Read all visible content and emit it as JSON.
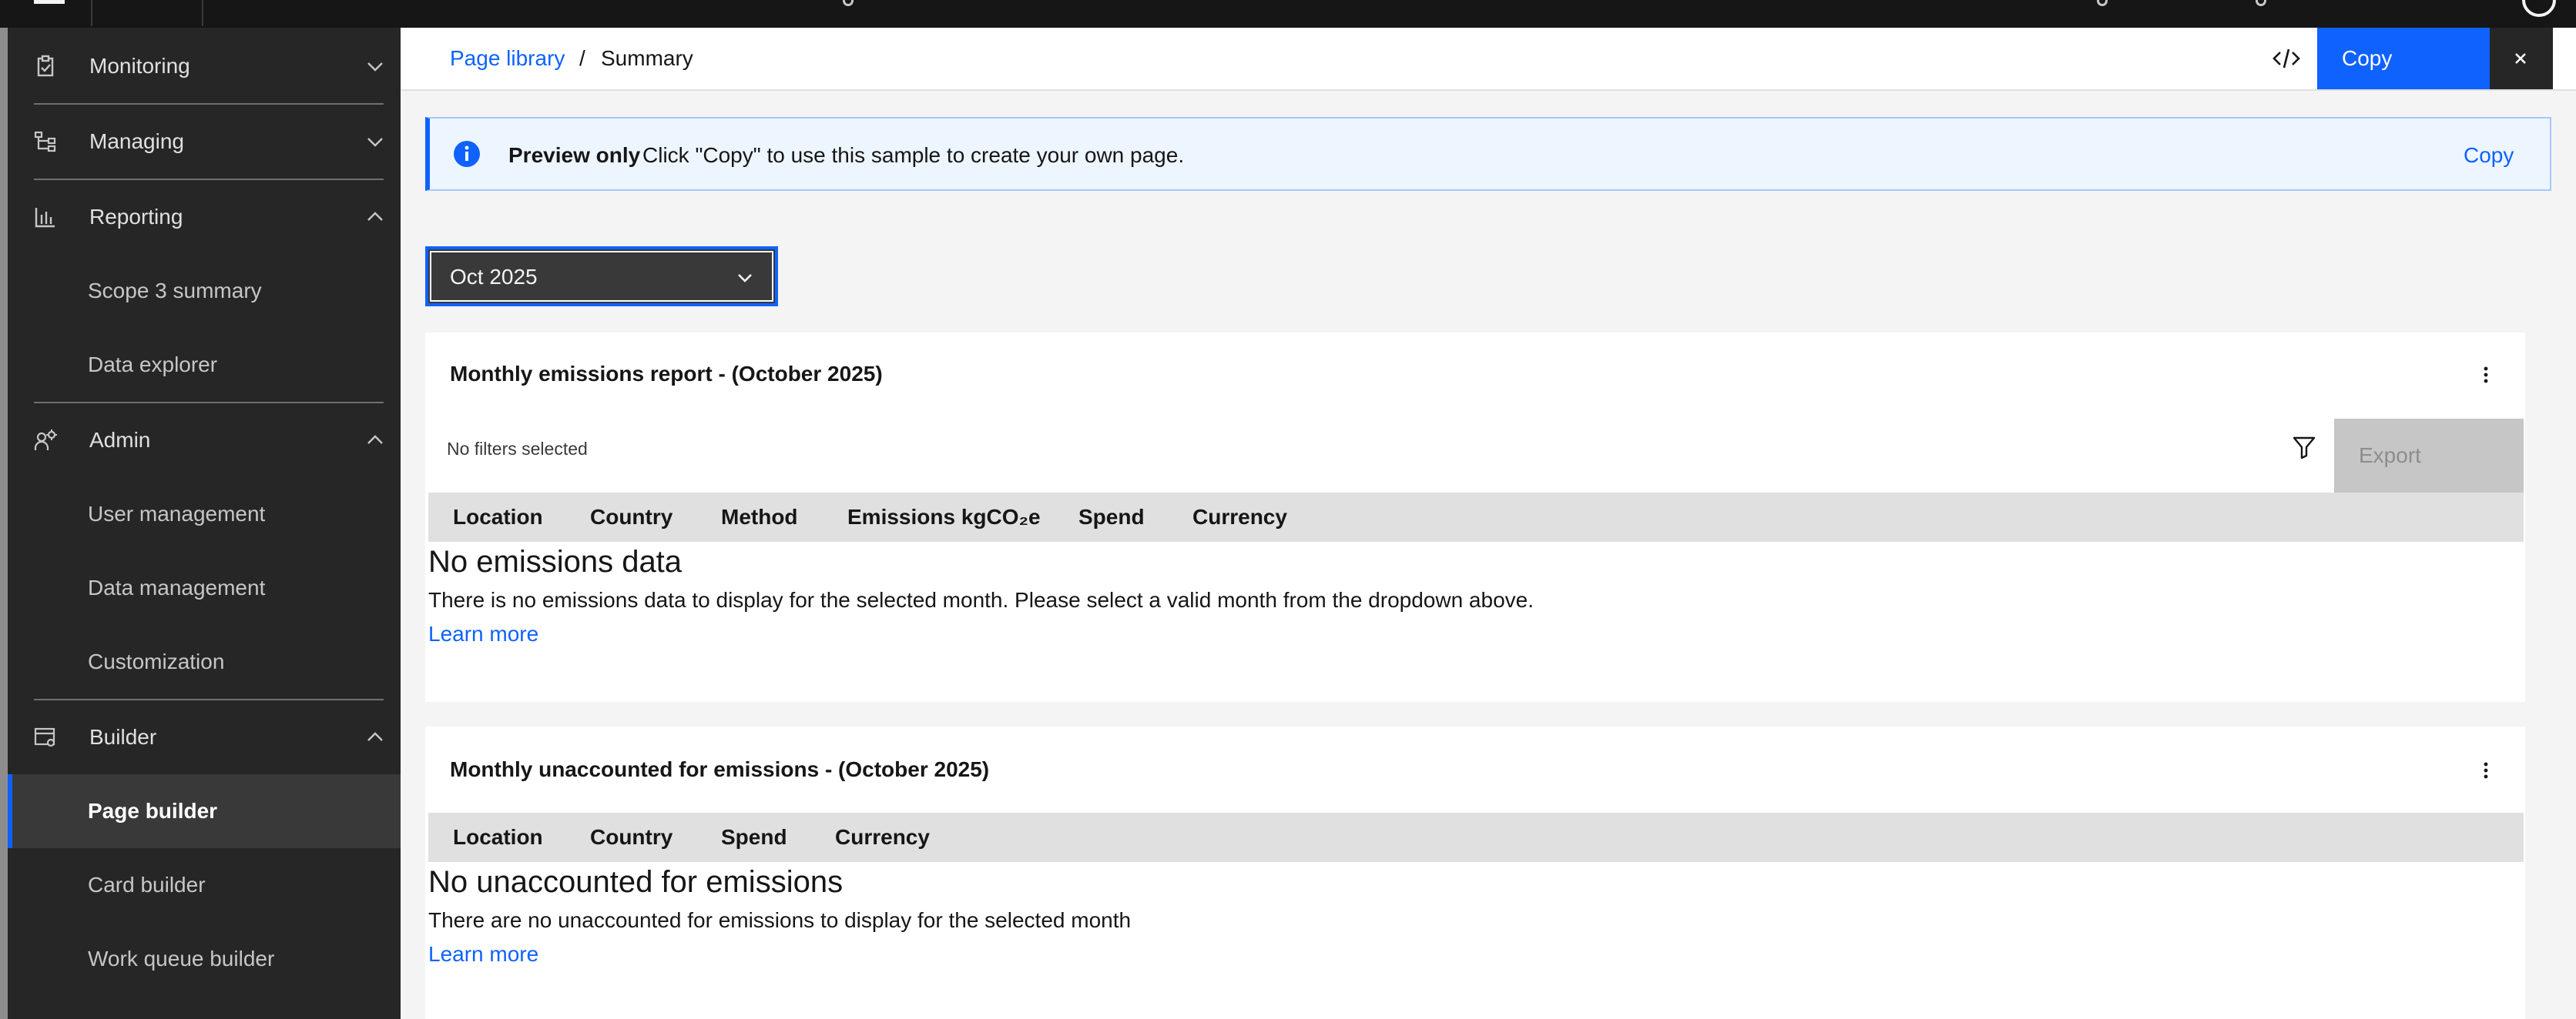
{
  "header": {
    "breadcrumb_link": "Page library",
    "breadcrumb_sep": "/",
    "breadcrumb_current": "Summary",
    "copy_label": "Copy"
  },
  "sidebar": {
    "items": [
      {
        "label": "Monitoring",
        "icon": "clipboard-icon",
        "expanded": false
      },
      {
        "label": "Managing",
        "icon": "hierarchy-icon",
        "expanded": false
      },
      {
        "label": "Reporting",
        "icon": "bar-chart-icon",
        "expanded": true,
        "children": [
          "Scope 3 summary",
          "Data explorer"
        ]
      },
      {
        "label": "Admin",
        "icon": "user-admin-icon",
        "expanded": true,
        "children": [
          "User management",
          "Data management",
          "Customization"
        ]
      },
      {
        "label": "Builder",
        "icon": "builder-icon",
        "expanded": true,
        "children": [
          "Page builder",
          "Card builder",
          "Work queue builder"
        ]
      }
    ],
    "selected": "Page builder"
  },
  "notification": {
    "title": "Preview only",
    "message": "Click \"Copy\" to use this sample to create your own page.",
    "action": "Copy"
  },
  "month_dropdown": {
    "value": "Oct 2025"
  },
  "emissions_card": {
    "title": "Monthly emissions report - (October 2025)",
    "filter_label": "No filters selected",
    "export_label": "Export",
    "columns": [
      "Location",
      "Country",
      "Method",
      "Emissions kgCO₂e",
      "Spend",
      "Currency"
    ],
    "empty_title": "No emissions data",
    "empty_message": "There is no emissions data to display for the selected month. Please select a valid month from the dropdown above.",
    "learn_more": "Learn more"
  },
  "unaccounted_card": {
    "title": "Monthly unaccounted for emissions - (October 2025)",
    "columns": [
      "Location",
      "Country",
      "Spend",
      "Currency"
    ],
    "empty_title": "No unaccounted for emissions",
    "empty_message": "There are no unaccounted for emissions to display for the selected month",
    "learn_more": "Learn more"
  },
  "colors": {
    "accent": "#0f62fe",
    "sidebar_bg": "#262626",
    "topbar_bg": "#161616",
    "notification_bg": "#edf5ff"
  }
}
